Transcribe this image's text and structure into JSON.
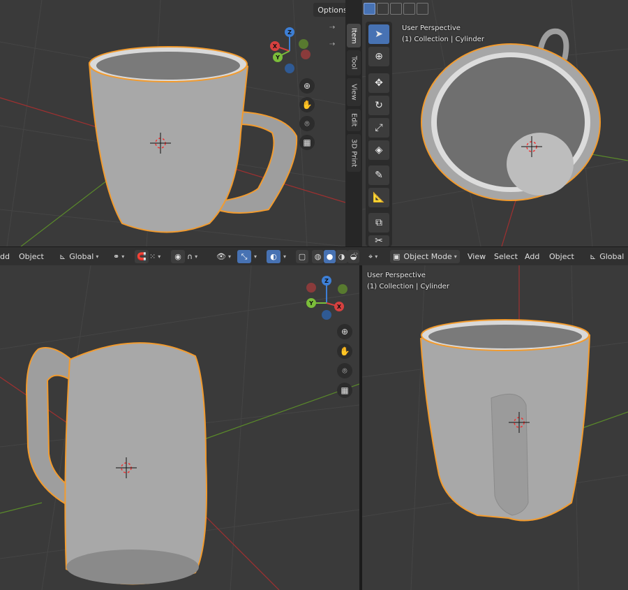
{
  "tl_viewport": {
    "options_label": "Options",
    "side_tabs": [
      "Item",
      "Tool",
      "View",
      "Edit",
      "3D Print"
    ],
    "nav_icons": [
      "zoom-icon",
      "hand-pan-icon",
      "camera-icon",
      "grid-icon"
    ]
  },
  "tr_viewport": {
    "overlay_title": "User Perspective",
    "overlay_subtitle": "(1) Collection | Cylinder",
    "tools": [
      "select-box-icon",
      "cursor-icon",
      "move-icon",
      "rotate-icon",
      "scale-icon",
      "transform-icon",
      "annotate-icon",
      "measure-icon",
      "add-cube-icon",
      "extra-tool-icon"
    ]
  },
  "header_left": {
    "menu_add": "dd",
    "menu_object": "Object",
    "orientation": "Global"
  },
  "header_right": {
    "mode": "Object Mode",
    "menu_view": "View",
    "menu_select": "Select",
    "menu_add": "Add",
    "menu_object": "Object",
    "orientation": "Global"
  },
  "br_viewport": {
    "overlay_title": "User Perspective",
    "overlay_subtitle": "(1) Collection | Cylinder"
  },
  "gizmo_axes": {
    "x": "X",
    "y": "Y",
    "z": "Z"
  },
  "colors": {
    "selection_outline": "#f29b2e",
    "axis_x": "#d6403f",
    "axis_y": "#7bbd3a",
    "axis_z": "#3d7fd6",
    "active_tool": "#4772b3",
    "viewport_bg": "#3a3a3a"
  }
}
